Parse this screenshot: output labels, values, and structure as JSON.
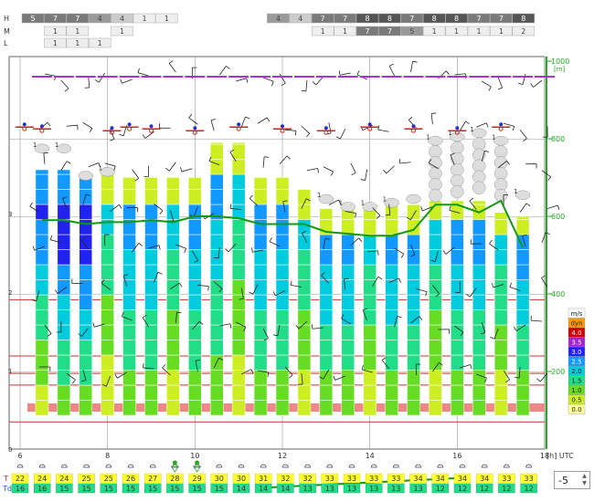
{
  "colors": {
    "grid": "#666666",
    "axis_green": "#22aa22",
    "line_green": "#119911",
    "red_line": "#cc3333",
    "red_band": "#ee8888",
    "purple": "#aa33cc",
    "blue_dot": "#2233cc",
    "red_dot": "#cc2222",
    "cloud_fill": "#dddddd",
    "temp_cell": "#ffff33",
    "dew_cell": "#22dd88"
  },
  "legend": {
    "labels": [
      "m/s",
      "dyn",
      "4.0",
      "3.5",
      "3.0",
      "2.5",
      "2.0",
      "1.5",
      "1.0",
      "0.5",
      "0.0"
    ],
    "colors": [
      "#ffffff",
      "#ff9900",
      "#cc0000",
      "#aa22cc",
      "#2222ee",
      "#1199ff",
      "#00ccdd",
      "#22dd88",
      "#66dd22",
      "#ccee22",
      "#ffff99"
    ]
  },
  "cloud_bars": {
    "H": {
      "label": "H",
      "cells": [
        {
          "v": "5",
          "s": 3
        },
        {
          "v": "7",
          "s": 3
        },
        {
          "v": "7",
          "s": 3
        },
        {
          "v": "4",
          "s": 2
        },
        {
          "v": "4",
          "s": 1
        },
        {
          "v": "1",
          "s": 0
        },
        {
          "v": "1",
          "s": 0
        },
        {
          "v": "",
          "s": -1
        },
        {
          "v": "",
          "s": -1
        },
        {
          "v": "",
          "s": -1
        },
        {
          "v": "",
          "s": -1
        },
        {
          "v": "4",
          "s": 2
        },
        {
          "v": "4",
          "s": 1
        },
        {
          "v": "7",
          "s": 3
        },
        {
          "v": "7",
          "s": 3
        },
        {
          "v": "8",
          "s": 4
        },
        {
          "v": "8",
          "s": 4
        },
        {
          "v": "7",
          "s": 3
        },
        {
          "v": "8",
          "s": 4
        },
        {
          "v": "8",
          "s": 4
        },
        {
          "v": "7",
          "s": 3
        },
        {
          "v": "7",
          "s": 3
        },
        {
          "v": "8",
          "s": 4
        }
      ]
    },
    "M": {
      "label": "M",
      "cells": [
        {
          "v": "",
          "s": -1
        },
        {
          "v": "1",
          "s": 0
        },
        {
          "v": "1",
          "s": 0
        },
        {
          "v": "",
          "s": -1
        },
        {
          "v": "1",
          "s": 0
        },
        {
          "v": "",
          "s": -1
        },
        {
          "v": "",
          "s": -1
        },
        {
          "v": "",
          "s": -1
        },
        {
          "v": "",
          "s": -1
        },
        {
          "v": "",
          "s": -1
        },
        {
          "v": "",
          "s": -1
        },
        {
          "v": "",
          "s": -1
        },
        {
          "v": "",
          "s": -1
        },
        {
          "v": "1",
          "s": 0
        },
        {
          "v": "1",
          "s": 0
        },
        {
          "v": "7",
          "s": 3
        },
        {
          "v": "7",
          "s": 3
        },
        {
          "v": "5",
          "s": 2
        },
        {
          "v": "1",
          "s": 0
        },
        {
          "v": "1",
          "s": 0
        },
        {
          "v": "1",
          "s": 0
        },
        {
          "v": "1",
          "s": 0
        },
        {
          "v": "2",
          "s": 0
        }
      ]
    },
    "L": {
      "label": "L",
      "cells": [
        {
          "v": "",
          "s": -1
        },
        {
          "v": "1",
          "s": 0
        },
        {
          "v": "1",
          "s": 0
        },
        {
          "v": "1",
          "s": 0
        }
      ]
    }
  },
  "chart_data": {
    "type": "meteogram",
    "x_ticks": [
      "6",
      "8",
      "10",
      "12",
      "14",
      "16",
      "18"
    ],
    "x_unit": "[h] UTC",
    "y_right_ticks": [
      "200",
      "400",
      "600",
      "800",
      "1000"
    ],
    "y_right_unit": "[m]",
    "y_left_ticks": [
      "0",
      "1",
      "2",
      "3"
    ],
    "hours": [
      6.5,
      7,
      7.5,
      8,
      8.5,
      9,
      9.5,
      10,
      10.5,
      11,
      11.5,
      12,
      12.5,
      13,
      13.5,
      14,
      14.5,
      15,
      15.5,
      16,
      16.5,
      17,
      17.5
    ],
    "thermal_top_m": [
      720,
      720,
      700,
      710,
      700,
      700,
      700,
      700,
      790,
      790,
      700,
      700,
      670,
      620,
      620,
      620,
      630,
      630,
      640,
      640,
      640,
      610,
      600
    ],
    "cloud_base_m": [
      770,
      770,
      700,
      710,
      null,
      null,
      null,
      null,
      null,
      null,
      null,
      null,
      null,
      640,
      620,
      620,
      630,
      640,
      790,
      800,
      810,
      790,
      650
    ],
    "cloud_top_m": [
      null,
      null,
      null,
      null,
      null,
      null,
      null,
      null,
      null,
      null,
      null,
      null,
      null,
      null,
      null,
      null,
      null,
      null,
      810,
      820,
      820,
      810,
      null
    ],
    "cloud_labels": [
      "1",
      "1",
      "",
      "1",
      "",
      "",
      "",
      "",
      "",
      "",
      "",
      "",
      "",
      "1",
      "1",
      "1",
      "1",
      "",
      "1",
      "1",
      "1",
      "1",
      "1"
    ],
    "green_line_m": [
      590,
      590,
      580,
      585,
      585,
      590,
      585,
      600,
      600,
      595,
      580,
      580,
      580,
      560,
      555,
      550,
      550,
      565,
      630,
      630,
      610,
      640,
      520
    ],
    "inversion_level_m": 830,
    "purple_level_m": 960,
    "red_lines_m": [
      70,
      165,
      195,
      240,
      385
    ],
    "lower_green_line": {
      "start_hour": 11.5,
      "end_hour": 16,
      "start_m": -100,
      "end_m": -75
    },
    "temperature": [
      22,
      24,
      24,
      25,
      25,
      26,
      27,
      28,
      29,
      30,
      30,
      31,
      32,
      32,
      33,
      33,
      33,
      33,
      34,
      34,
      34,
      34,
      33,
      33
    ],
    "dewpoint": [
      16,
      16,
      15,
      15,
      15,
      15,
      15,
      15,
      15,
      15,
      14,
      14,
      14,
      13,
      13,
      13,
      13,
      13,
      13,
      12,
      12,
      12,
      12,
      12
    ],
    "temp_label": "T",
    "dew_label": "Td"
  },
  "controls": {
    "offset_value": "-5"
  }
}
